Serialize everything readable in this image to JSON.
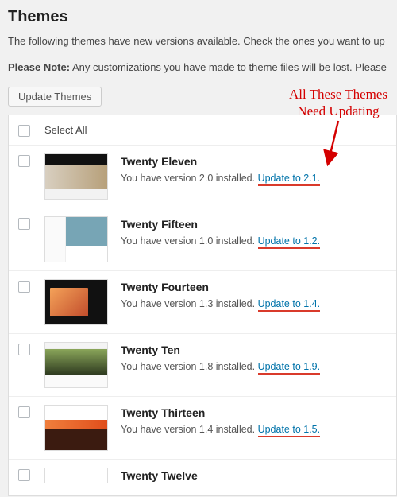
{
  "header": "Themes",
  "intro": "The following themes have new versions available. Check the ones you want to up",
  "note_label": "Please Note:",
  "note_text": " Any customizations you have made to theme files will be lost. Please",
  "button": "Update Themes",
  "select_all": "Select All",
  "annotation": {
    "line1": "All These Themes",
    "line2": "Need Updating"
  },
  "themes": [
    {
      "name": "Twenty Eleven",
      "line": "You have version 2.0 installed. ",
      "update": "Update to 2.1."
    },
    {
      "name": "Twenty Fifteen",
      "line": "You have version 1.0 installed. ",
      "update": "Update to 1.2."
    },
    {
      "name": "Twenty Fourteen",
      "line": "You have version 1.3 installed. ",
      "update": "Update to 1.4."
    },
    {
      "name": "Twenty Ten",
      "line": "You have version 1.8 installed. ",
      "update": "Update to 1.9."
    },
    {
      "name": "Twenty Thirteen",
      "line": "You have version 1.4 installed. ",
      "update": "Update to 1.5."
    },
    {
      "name": "Twenty Twelve",
      "line": "",
      "update": ""
    }
  ]
}
